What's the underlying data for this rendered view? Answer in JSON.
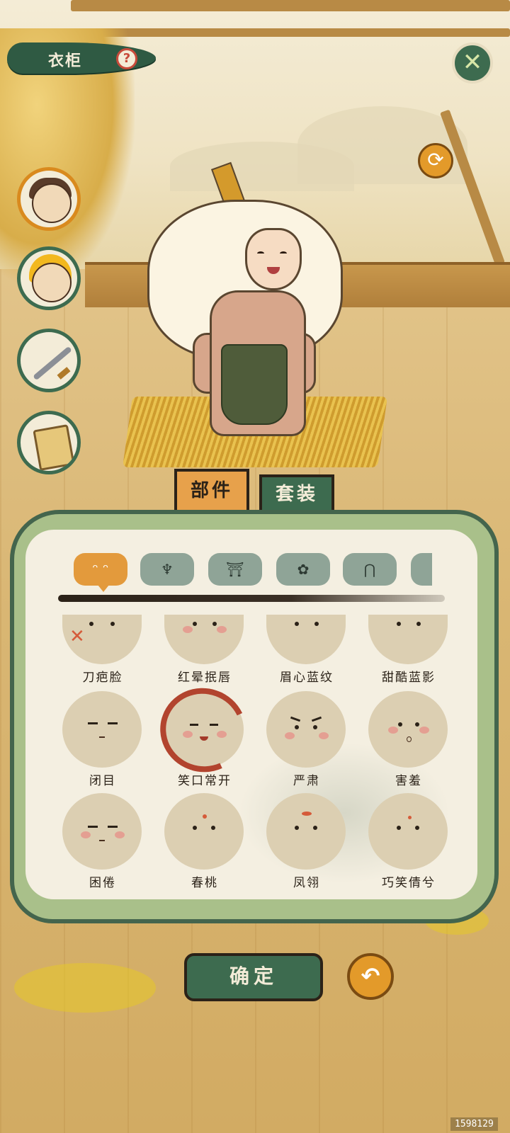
{
  "header": {
    "title": "衣柜",
    "help_icon": "question-mark-icon",
    "close_icon": "close-x-icon",
    "colors": {
      "banner": "#2f5a43",
      "accent": "#e39a2a"
    }
  },
  "side_categories": [
    {
      "icon": "male-hero-portrait-icon"
    },
    {
      "icon": "golden-hair-hero-portrait-icon"
    },
    {
      "icon": "sword-icon"
    },
    {
      "icon": "scroll-icon"
    }
  ],
  "tabs": [
    {
      "label": "部件",
      "active": true
    },
    {
      "label": "套装",
      "active": false
    }
  ],
  "part_categories": [
    {
      "icon": "face-expression-icon",
      "glyph": "ᵔ ᵔ",
      "active": true
    },
    {
      "icon": "hairstyle-icon",
      "glyph": "♆",
      "active": false
    },
    {
      "icon": "clothing-icon",
      "glyph": "⛩",
      "active": false
    },
    {
      "icon": "flower-accessory-icon",
      "glyph": "✿",
      "active": false
    },
    {
      "icon": "pants-icon",
      "glyph": "⋂",
      "active": false
    },
    {
      "icon": "more-icon",
      "glyph": "◐",
      "active": false
    }
  ],
  "expressions": [
    {
      "label": "刀疤脸"
    },
    {
      "label": "红晕抿唇"
    },
    {
      "label": "眉心蓝纹"
    },
    {
      "label": "甜酷蓝影"
    },
    {
      "label": "闭目"
    },
    {
      "label": "笑口常开",
      "selected": true
    },
    {
      "label": "严肃"
    },
    {
      "label": "害羞"
    },
    {
      "label": "困倦"
    },
    {
      "label": "春桃"
    },
    {
      "label": "凤翎"
    },
    {
      "label": "巧笑倩兮"
    }
  ],
  "footer": {
    "confirm_label": "确定",
    "undo_icon": "undo-arrow-icon",
    "rotate_icon": "rotate-arrows-icon"
  },
  "watermark": "1598129"
}
